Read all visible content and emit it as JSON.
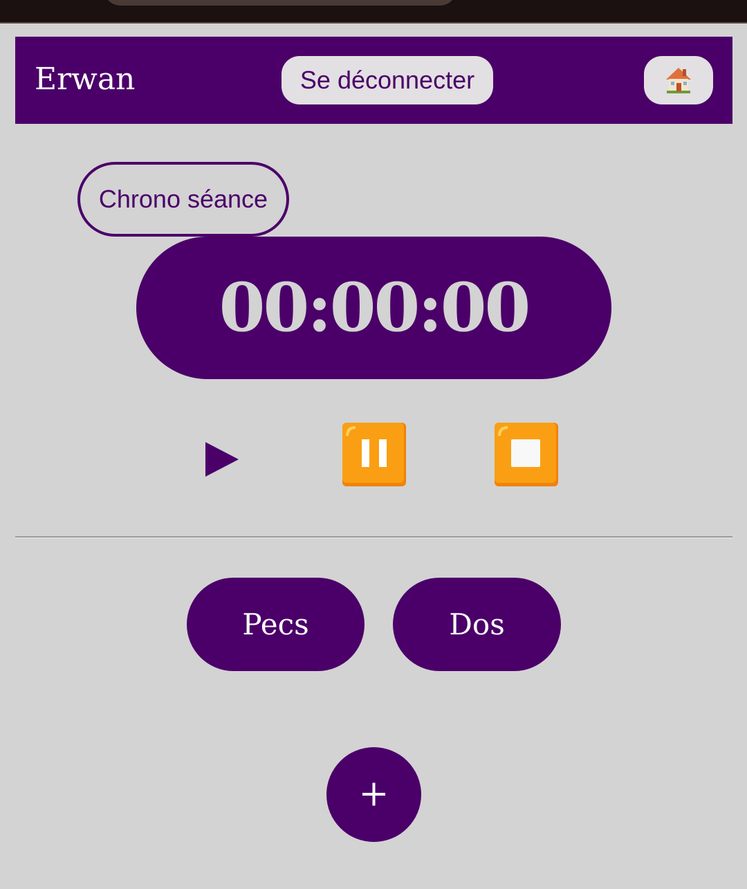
{
  "header": {
    "user_name": "Erwan",
    "logout_label": "Se déconnecter",
    "home_icon": "house-icon"
  },
  "chrono": {
    "label": "Chrono séance",
    "time": "00:00:00"
  },
  "controls": {
    "play_icon": "play-icon",
    "pause_icon": "pause-icon",
    "stop_icon": "stop-icon"
  },
  "categories": [
    {
      "label": "Pecs"
    },
    {
      "label": "Dos"
    }
  ],
  "add_icon": "plus-icon",
  "colors": {
    "primary": "#4b0069",
    "background": "#d3d3d3",
    "button_light": "#e2e0e2",
    "control_orange": "#f7980a"
  }
}
